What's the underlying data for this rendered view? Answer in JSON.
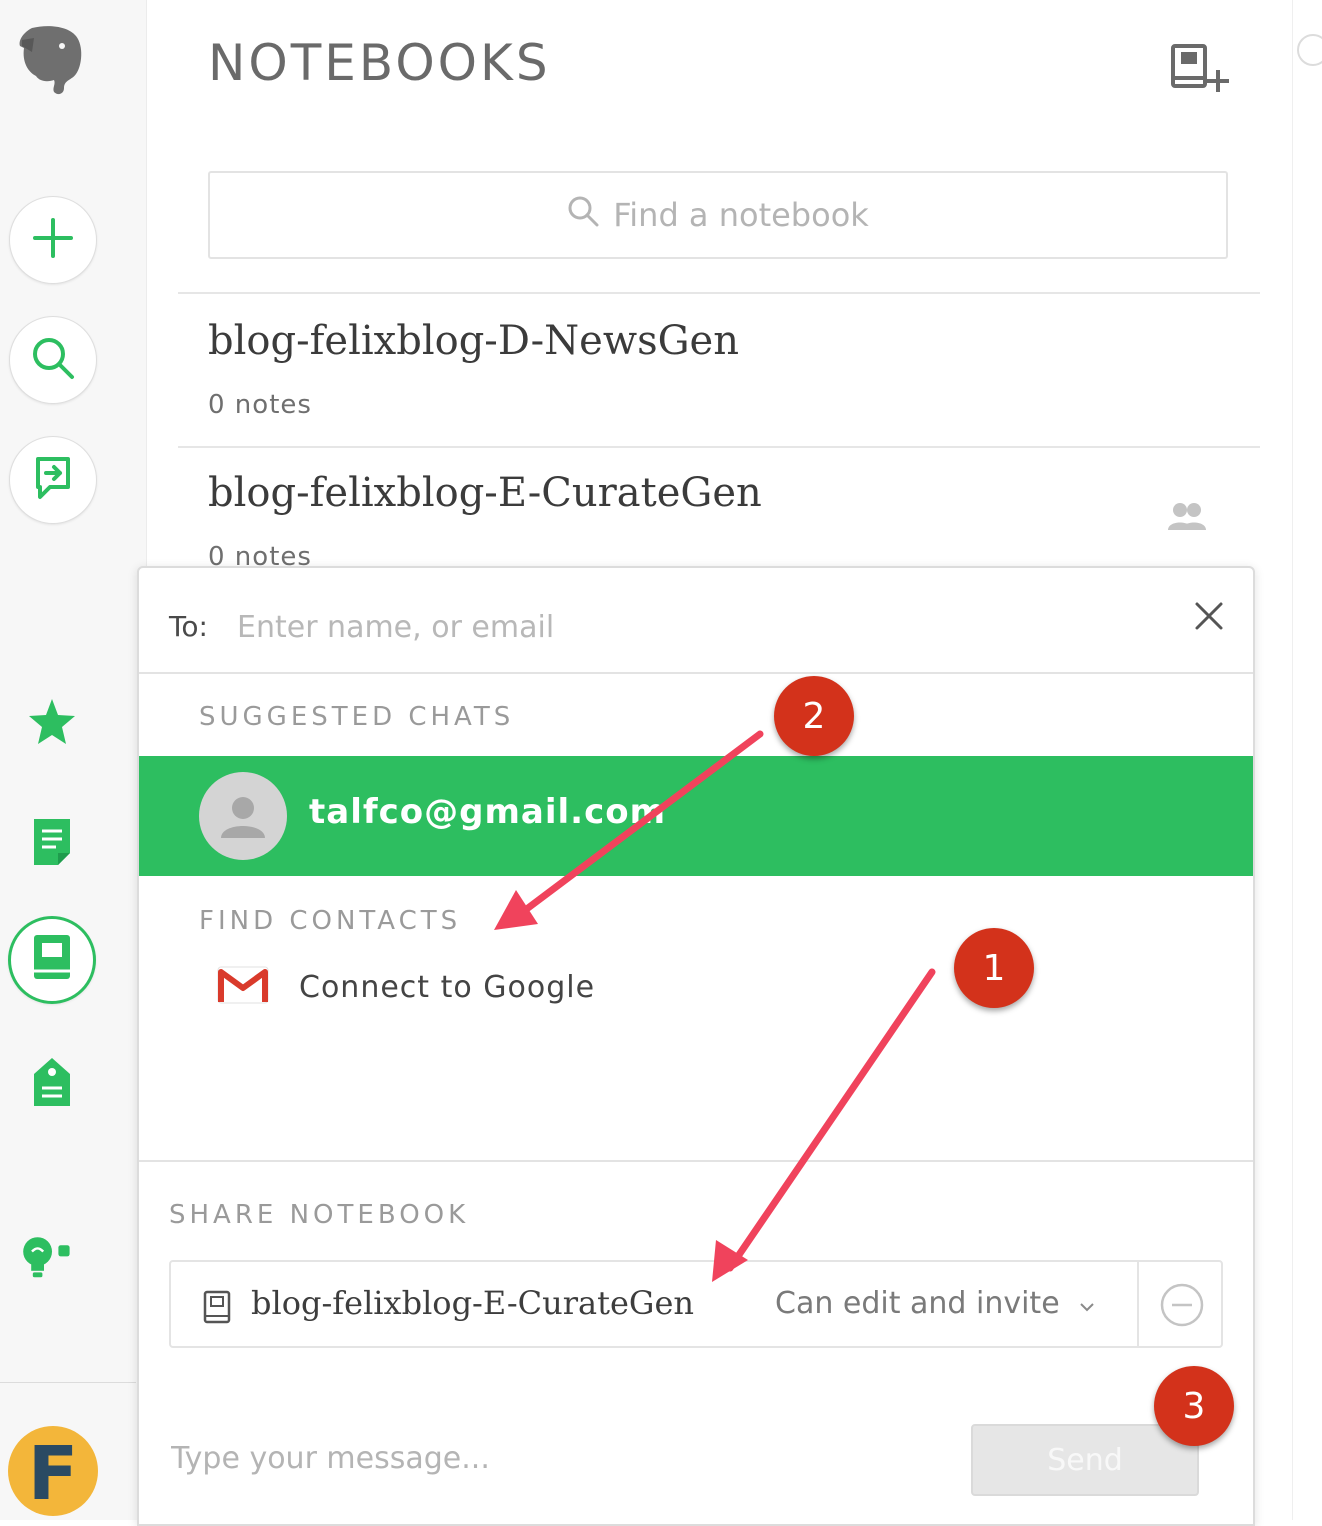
{
  "sidebar": {
    "logo_icon": "evernote-elephant-icon",
    "buttons": [
      {
        "name": "new-note-button",
        "icon": "plus-icon"
      },
      {
        "name": "search-button",
        "icon": "search-icon"
      },
      {
        "name": "work-chat-button",
        "icon": "chat-share-icon"
      }
    ],
    "nav": [
      {
        "name": "shortcuts",
        "icon": "star-icon"
      },
      {
        "name": "notes",
        "icon": "note-icon"
      },
      {
        "name": "notebooks",
        "icon": "notebook-icon",
        "active": true
      },
      {
        "name": "tags",
        "icon": "tag-icon"
      },
      {
        "name": "tips",
        "icon": "lightbulb-icon"
      }
    ],
    "avatar_letter": "F"
  },
  "notebooks": {
    "title": "NOTEBOOKS",
    "search_placeholder": "Find a notebook",
    "items": [
      {
        "name": "blog-felixblog-D-NewsGen",
        "count": "0 notes",
        "shared": false
      },
      {
        "name": "blog-felixblog-E-CurateGen",
        "count": "0 notes",
        "shared": true
      }
    ]
  },
  "share_dialog": {
    "to_label": "To:",
    "to_placeholder": "Enter name, or email",
    "suggested_label": "SUGGESTED CHATS",
    "suggested_contact": "talfco@gmail.com",
    "find_contacts_label": "FIND CONTACTS",
    "connect_google_label": "Connect to Google",
    "share_notebook_label": "SHARE NOTEBOOK",
    "shared_notebook_name": "blog-felixblog-E-CurateGen",
    "permission": "Can edit and invite",
    "message_placeholder": "Type your message...",
    "send_label": "Send"
  },
  "annotations": {
    "badges": [
      "1",
      "2",
      "3"
    ],
    "color": "#d3321b",
    "arrow_color": "#f0435c"
  },
  "colors": {
    "accent": "#2dbe60"
  }
}
